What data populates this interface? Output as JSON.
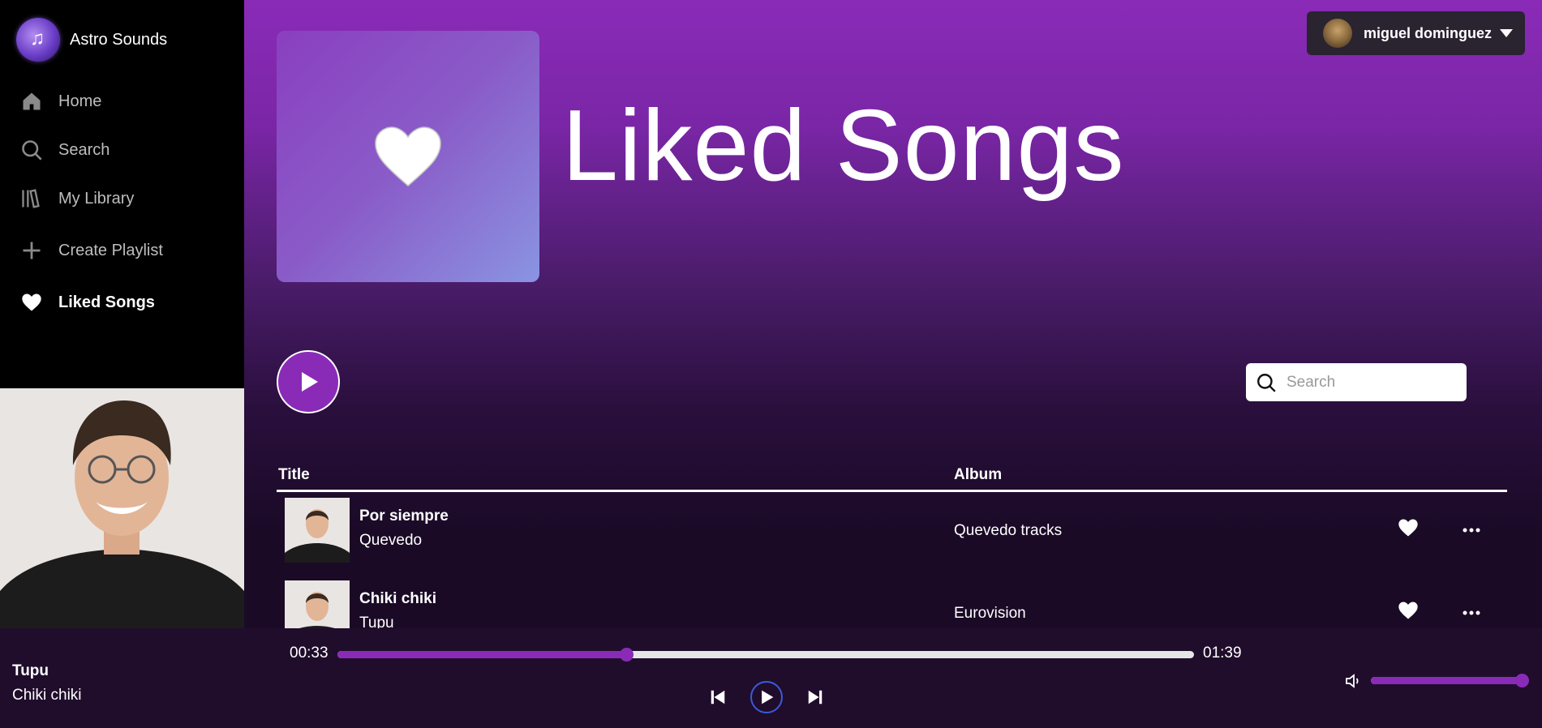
{
  "app": {
    "name": "Astro Sounds"
  },
  "sidebar": {
    "items": [
      {
        "label": "Home",
        "icon": "home-icon"
      },
      {
        "label": "Search",
        "icon": "search-icon"
      },
      {
        "label": "My Library",
        "icon": "library-icon"
      },
      {
        "label": "Create Playlist",
        "icon": "plus-icon"
      },
      {
        "label": "Liked Songs",
        "icon": "heart-icon",
        "active": true
      }
    ]
  },
  "header": {
    "user_name": "miguel dominguez"
  },
  "playlist": {
    "title": "Liked Songs"
  },
  "search": {
    "placeholder": "Search"
  },
  "table": {
    "columns": {
      "title": "Title",
      "album": "Album"
    },
    "rows": [
      {
        "title": "Por siempre",
        "artist": "Quevedo",
        "album": "Quevedo tracks"
      },
      {
        "title": "Chiki chiki",
        "artist": "Tupu",
        "album": "Eurovision"
      }
    ]
  },
  "player": {
    "track_title": "Tupu",
    "track_artist": "Chiki chiki",
    "elapsed": "00:33",
    "duration": "01:39",
    "progress_fraction": 0.337,
    "volume_fraction": 1.0
  },
  "colors": {
    "accent": "#8a2bb8",
    "player_bg": "#200d2b",
    "sidebar_bg": "#000000"
  }
}
